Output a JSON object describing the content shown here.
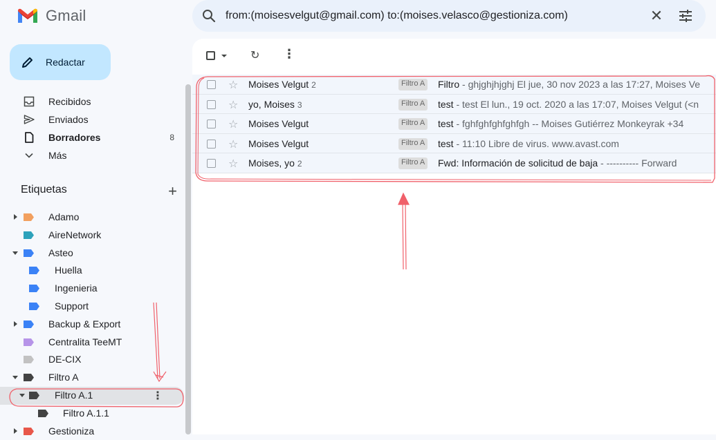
{
  "app": {
    "name": "Gmail"
  },
  "search": {
    "query": "from:(moisesvelgut@gmail.com) to:(moises.velasco@gestioniza.com)"
  },
  "compose": {
    "label": "Redactar"
  },
  "nav": {
    "items": [
      {
        "label": "Recibidos",
        "count": "",
        "icon": "inbox-icon"
      },
      {
        "label": "Enviados",
        "count": "",
        "icon": "send-icon"
      },
      {
        "label": "Borradores",
        "count": "8",
        "icon": "draft-icon"
      },
      {
        "label": "Más",
        "count": "",
        "icon": "chevron-down-icon"
      }
    ]
  },
  "labels": {
    "heading": "Etiquetas",
    "items": [
      {
        "name": "Adamo",
        "color": "#f2a05f"
      },
      {
        "name": "AireNetwork",
        "color": "#2da2bb"
      },
      {
        "name": "Asteo",
        "color": "#3b82f6"
      },
      {
        "name": "Huella",
        "color": "#3b82f6"
      },
      {
        "name": "Ingenieria",
        "color": "#3b82f6"
      },
      {
        "name": "Support",
        "color": "#3b82f6"
      },
      {
        "name": "Backup & Export",
        "color": "#3b82f6"
      },
      {
        "name": "Centralita TeeMT",
        "color": "#b694e8"
      },
      {
        "name": "DE-CIX",
        "color": "#c2c2c2"
      },
      {
        "name": "Filtro A",
        "color": "#434343"
      },
      {
        "name": "Filtro A.1",
        "color": "#434343"
      },
      {
        "name": "Filtro A.1.1",
        "color": "#434343"
      },
      {
        "name": "Gestioniza",
        "color": "#e8574a"
      }
    ]
  },
  "emails": [
    {
      "sender": "Moises Velgut",
      "count": "2",
      "label": "Filtro A",
      "subject": "Filtro",
      "snippet": " - ghjghjhjghj El jue, 30 nov 2023 a las 17:27, Moises Ve"
    },
    {
      "sender": "yo, Moises",
      "count": "3",
      "label": "Filtro A",
      "subject": "test",
      "snippet": " - test El lun., 19 oct. 2020 a las 17:07, Moises Velgut (<n"
    },
    {
      "sender": "Moises Velgut",
      "count": "",
      "label": "Filtro A",
      "subject": "test",
      "snippet": " - fghfghfghfghfgh -- Moises Gutiérrez Monkeyrak +34"
    },
    {
      "sender": "Moises Velgut",
      "count": "",
      "label": "Filtro A",
      "subject": "test",
      "snippet": " - 11:10 Libre de virus. www.avast.com"
    },
    {
      "sender": "Moises, yo",
      "count": "2",
      "label": "Filtro A",
      "subject": "Fwd: Información de solicitud de baja",
      "snippet": " - ---------- Forward"
    }
  ],
  "colors": {
    "compose_bg": "#c2e7ff",
    "search_bg": "#eaf1fb",
    "annotation": "#f0606a"
  }
}
